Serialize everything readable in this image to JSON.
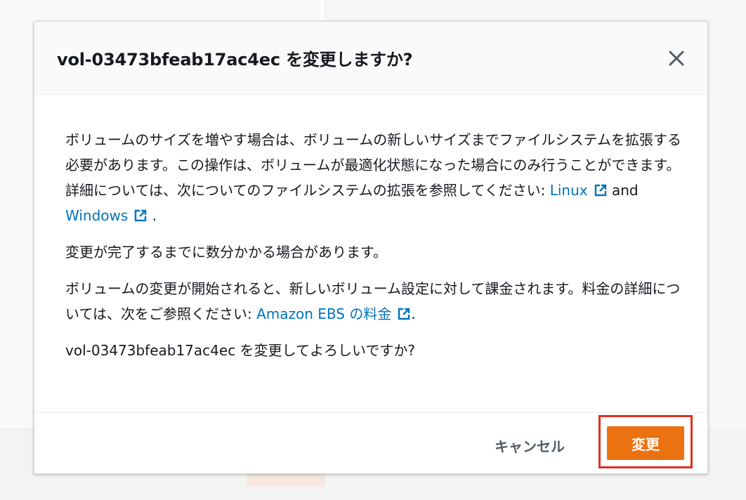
{
  "dialog": {
    "title": "vol-03473bfeab17ac4ec を変更しますか?",
    "close_icon": "close-icon"
  },
  "body": {
    "p1": {
      "text": "ボリュームのサイズを増やす場合は、ボリュームの新しいサイズまでファイルシステムを拡張する必要があります。この操作は、ボリュームが最適化状態になった場合にのみ行うことができます。詳細については、次についてのファイルシステムの拡張を参照してください: ",
      "link1": "Linux",
      "and": " and ",
      "link2": "Windows",
      "end": " ."
    },
    "p2": "変更が完了するまでに数分かかる場合があります。",
    "p3": {
      "text": "ボリュームの変更が開始されると、新しいボリューム設定に対して課金されます。料金の詳細については、次をご参照ください: ",
      "link": "Amazon EBS の料金",
      "end": "."
    },
    "p4": "vol-03473bfeab17ac4ec を変更してよろしいですか?"
  },
  "footer": {
    "cancel_label": "キャンセル",
    "modify_label": "変更"
  },
  "colors": {
    "primary": "#ec7211",
    "link": "#0073bb",
    "highlight": "#e0301e"
  }
}
